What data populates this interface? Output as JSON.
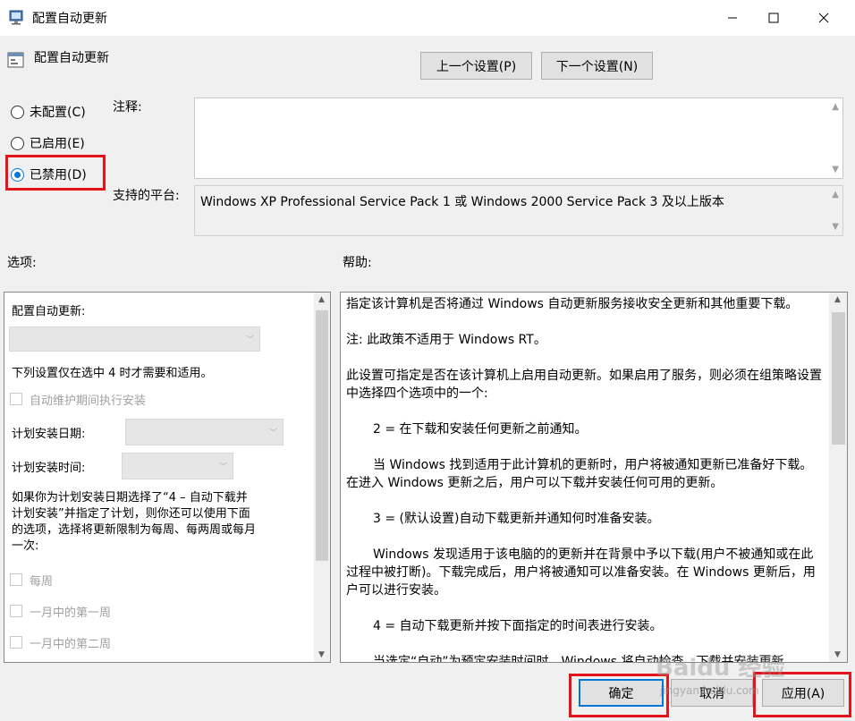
{
  "window": {
    "title": "配置自动更新"
  },
  "header": {
    "title": "配置自动更新"
  },
  "nav": {
    "prev_label": "上一个设置(P)",
    "next_label": "下一个设置(N)"
  },
  "state": {
    "not_configured": "未配置(C)",
    "enabled": "已启用(E)",
    "disabled": "已禁用(D)",
    "selected": "disabled"
  },
  "comment": {
    "label": "注释:",
    "value": ""
  },
  "platform": {
    "label": "支持的平台:",
    "value": "Windows XP Professional Service Pack 1 或 Windows 2000 Service Pack 3 及以上版本"
  },
  "options": {
    "label": "选项:",
    "config_label": "配置自动更新:",
    "config_value": "",
    "note": "下列设置仅在选中 4 时才需要和适用。",
    "maintenance_install": "自动维护期间执行安装",
    "schedule_day_label": "计划安装日期:",
    "schedule_time_label": "计划安装时间:",
    "paragraph_line1": "如果你为计划安装日期选择了“4 – 自动下载并",
    "paragraph_line2": "计划安装”并指定了计划，则你还可以使用下面",
    "paragraph_line3": "的选项，选择将更新限制为每周、每两周或每月",
    "paragraph_line4": "一次:",
    "weekly": "每周",
    "first_week": "一月中的第一周",
    "second_week": "一月中的第二周"
  },
  "help": {
    "label": "帮助:",
    "p1": "指定该计算机是否将通过 Windows 自动更新服务接收安全更新和其他重要下载。",
    "p2": "注: 此政策不适用于 Windows RT。",
    "p3": "此设置可指定是否在该计算机上启用自动更新。如果启用了服务，则必须在组策略设置中选择四个选项中的一个:",
    "p4": "2 = 在下载和安装任何更新之前通知。",
    "p5": "当 Windows 找到适用于此计算机的更新时，用户将被通知更新已准备好下载。在进入 Windows 更新之后，用户可以下载并安装任何可用的更新。",
    "p6": "3 = (默认设置)自动下载更新并通知何时准备安装。",
    "p7": "Windows 发现适用于该电脑的的更新并在背景中予以下载(用户不被通知或在此过程中被打断)。下载完成后，用户将被通知可以准备安装。在 Windows 更新后，用户可以进行安装。",
    "p8": "4 = 自动下载更新并按下面指定的时间表进行安装。",
    "p9": "当选定“自动”为预定安装时间时，Windows 将自动检查、下载并安装更新"
  },
  "footer": {
    "ok_label": "确定",
    "cancel_label": "取消",
    "apply_label": "应用(A)"
  },
  "watermark": {
    "text": "Baidu 经验",
    "url": "jingyan.baidu.com"
  }
}
